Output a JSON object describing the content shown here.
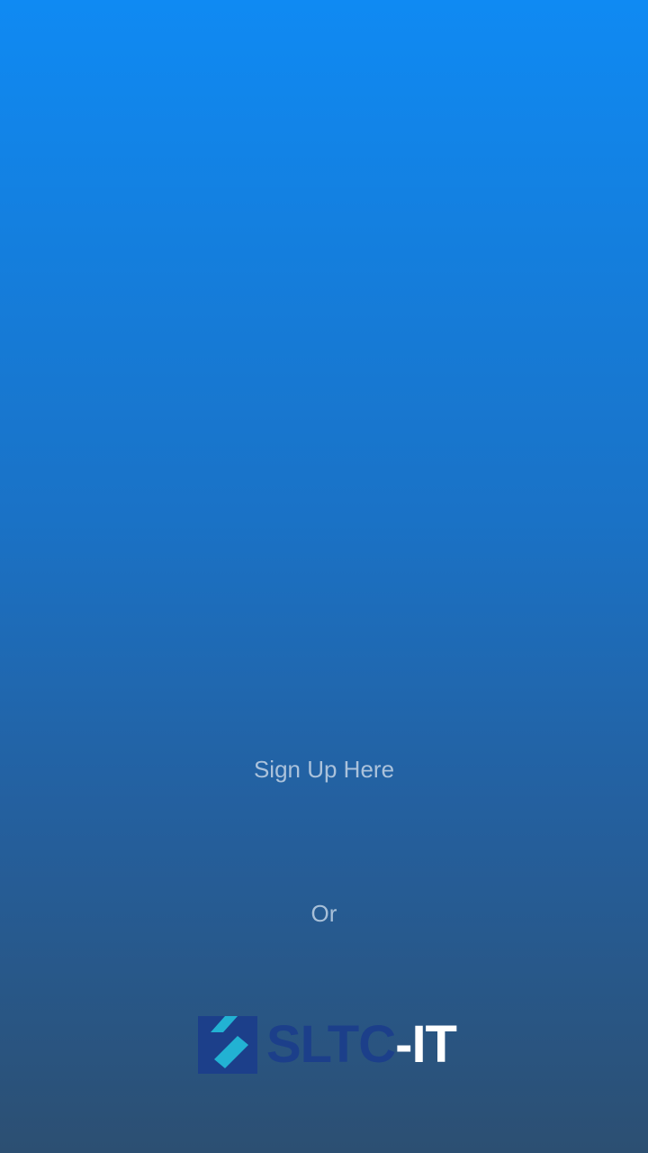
{
  "signup": {
    "label": "Sign Up Here"
  },
  "divider": {
    "text": "Or"
  },
  "logo": {
    "text_primary": "SLTC",
    "text_secondary": "-IT",
    "icon": "sltc-logo-icon"
  },
  "colors": {
    "background_top": "#0f8af3",
    "background_bottom": "#2c4f72",
    "link_text": "#b7cbe0",
    "logo_dark_blue": "#1c3f8a",
    "logo_cyan": "#22b2d3",
    "logo_white": "#ffffff"
  }
}
